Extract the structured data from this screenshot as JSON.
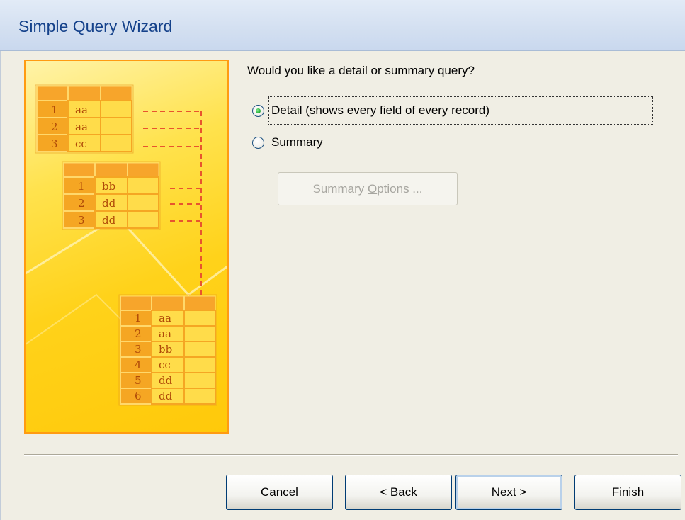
{
  "window": {
    "title": "Simple Query Wizard"
  },
  "illustration": {
    "table1_rows": [
      [
        "1",
        "aa"
      ],
      [
        "2",
        "aa"
      ],
      [
        "3",
        "cc"
      ]
    ],
    "table2_rows": [
      [
        "1",
        "bb"
      ],
      [
        "2",
        "dd"
      ],
      [
        "3",
        "dd"
      ]
    ],
    "result_rows": [
      [
        "1",
        "aa"
      ],
      [
        "2",
        "aa"
      ],
      [
        "3",
        "bb"
      ],
      [
        "4",
        "cc"
      ],
      [
        "5",
        "dd"
      ],
      [
        "6",
        "dd"
      ]
    ]
  },
  "main": {
    "question": "Would you like a detail or summary query?",
    "options": [
      {
        "accel": "D",
        "rest": "etail (shows every field of every record)",
        "selected": true
      },
      {
        "accel": "S",
        "rest": "ummary",
        "selected": false
      }
    ],
    "summary_options_button": {
      "pre": "Summary ",
      "accel": "O",
      "post": "ptions ..."
    }
  },
  "footer": {
    "cancel": "Cancel",
    "back": {
      "pre": "< ",
      "accel": "B",
      "post": "ack"
    },
    "next": {
      "accel": "N",
      "post": "ext >"
    },
    "finish": {
      "accel": "F",
      "post": "inish"
    }
  },
  "colors": {
    "title_text": "#15428b",
    "illustration_border": "#ff9b12",
    "illustration_table": "#f5a623",
    "dashed_line": "#e8542e",
    "radio_checked": "#2fb341"
  }
}
